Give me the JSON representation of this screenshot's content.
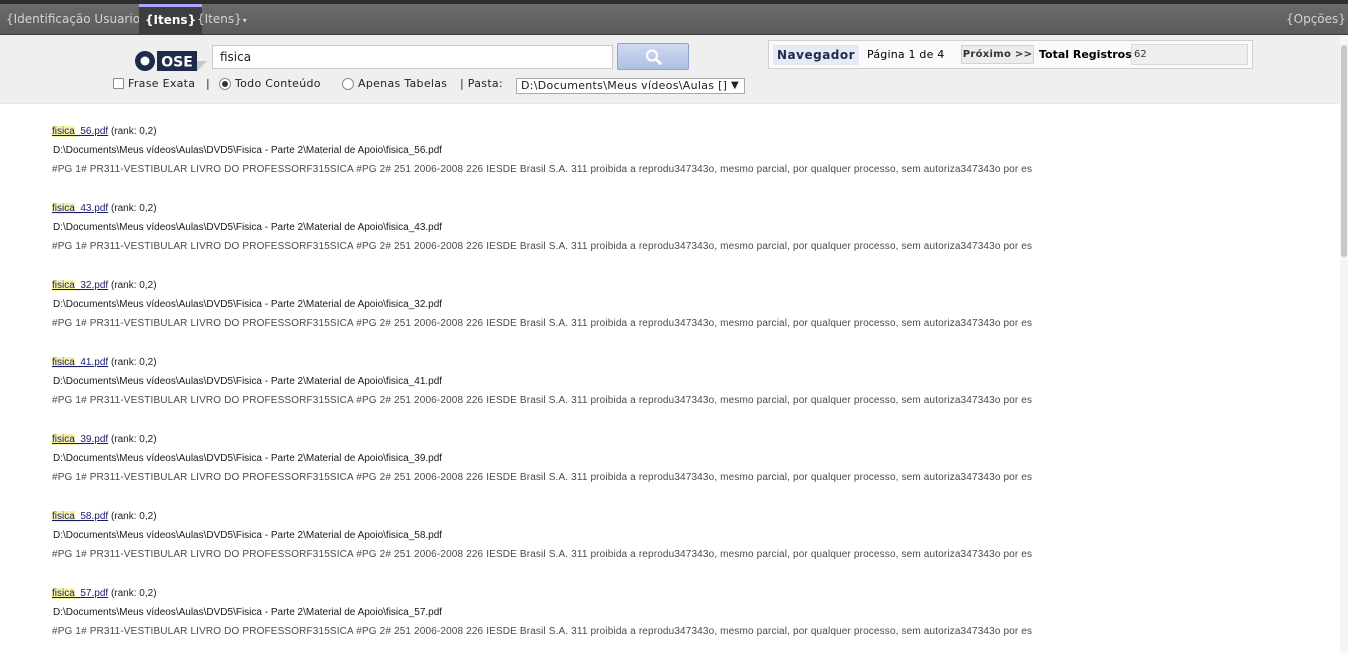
{
  "menu": {
    "identificacao": "{Identificação Usuario}",
    "itens_active": "{Itens}",
    "itens_dropdown": "{Itens}",
    "opcoes": "{Opções}"
  },
  "logo_text": "OSE",
  "search": {
    "query": "fisica",
    "button_icon": "search-icon"
  },
  "options": {
    "frase_exata": "Frase Exata",
    "frase_exata_checked": false,
    "sep1": "|",
    "todo_conteudo": "Todo Conteúdo",
    "todo_conteudo_selected": true,
    "apenas_tabelas": "Apenas Tabelas",
    "apenas_tabelas_selected": false,
    "pasta_label": "| Pasta:",
    "pasta_value": "D:\\Documents\\Meus vídeos\\Aulas []"
  },
  "navigator": {
    "title": "Navegador",
    "page_text": "Página 1 de 4",
    "next_label": "Próximo >>",
    "total_label": "Total Registros:",
    "total_value": "62"
  },
  "results": [
    {
      "name_hl": "fisica",
      "name_rest": "_56.pdf",
      "rank": "(rank: 0,2)",
      "path": "D:\\Documents\\Meus vídeos\\Aulas\\DVD5\\Fisica - Parte 2\\Material de Apoio\\fisica_56.pdf",
      "snippet": "#PG 1# PR311-VESTIBULAR LIVRO DO PROFESSORF315SICA #PG 2# 251 2006-2008 226 IESDE Brasil S.A. 311 proibida a reprodu347343o, mesmo parcial, por qualquer processo, sem autoriza347343o por es"
    },
    {
      "name_hl": "fisica",
      "name_rest": "_43.pdf",
      "rank": "(rank: 0,2)",
      "path": "D:\\Documents\\Meus vídeos\\Aulas\\DVD5\\Fisica - Parte 2\\Material de Apoio\\fisica_43.pdf",
      "snippet": "#PG 1# PR311-VESTIBULAR LIVRO DO PROFESSORF315SICA #PG 2# 251 2006-2008 226 IESDE Brasil S.A. 311 proibida a reprodu347343o, mesmo parcial, por qualquer processo, sem autoriza347343o por es"
    },
    {
      "name_hl": "fisica",
      "name_rest": "_32.pdf",
      "rank": "(rank: 0,2)",
      "path": "D:\\Documents\\Meus vídeos\\Aulas\\DVD5\\Fisica - Parte 2\\Material de Apoio\\fisica_32.pdf",
      "snippet": "#PG 1# PR311-VESTIBULAR LIVRO DO PROFESSORF315SICA #PG 2# 251 2006-2008 226 IESDE Brasil S.A. 311 proibida a reprodu347343o, mesmo parcial, por qualquer processo, sem autoriza347343o por es"
    },
    {
      "name_hl": "fisica",
      "name_rest": "_41.pdf",
      "rank": "(rank: 0,2)",
      "path": "D:\\Documents\\Meus vídeos\\Aulas\\DVD5\\Fisica - Parte 2\\Material de Apoio\\fisica_41.pdf",
      "snippet": "#PG 1# PR311-VESTIBULAR LIVRO DO PROFESSORF315SICA #PG 2# 251 2006-2008 226 IESDE Brasil S.A. 311 proibida a reprodu347343o, mesmo parcial, por qualquer processo, sem autoriza347343o por es"
    },
    {
      "name_hl": "fisica",
      "name_rest": "_39.pdf",
      "rank": "(rank: 0,2)",
      "path": "D:\\Documents\\Meus vídeos\\Aulas\\DVD5\\Fisica - Parte 2\\Material de Apoio\\fisica_39.pdf",
      "snippet": "#PG 1# PR311-VESTIBULAR LIVRO DO PROFESSORF315SICA #PG 2# 251 2006-2008 226 IESDE Brasil S.A. 311 proibida a reprodu347343o, mesmo parcial, por qualquer processo, sem autoriza347343o por es"
    },
    {
      "name_hl": "fisica",
      "name_rest": "_58.pdf",
      "rank": "(rank: 0,2)",
      "path": "D:\\Documents\\Meus vídeos\\Aulas\\DVD5\\Fisica - Parte 2\\Material de Apoio\\fisica_58.pdf",
      "snippet": "#PG 1# PR311-VESTIBULAR LIVRO DO PROFESSORF315SICA #PG 2# 251 2006-2008 226 IESDE Brasil S.A. 311 proibida a reprodu347343o, mesmo parcial, por qualquer processo, sem autoriza347343o por es"
    },
    {
      "name_hl": "fisica",
      "name_rest": "_57.pdf",
      "rank": "(rank: 0,2)",
      "path": "D:\\Documents\\Meus vídeos\\Aulas\\DVD5\\Fisica - Parte 2\\Material de Apoio\\fisica_57.pdf",
      "snippet": "#PG 1# PR311-VESTIBULAR LIVRO DO PROFESSORF315SICA #PG 2# 251 2006-2008 226 IESDE Brasil S.A. 311 proibida a reprodu347343o, mesmo parcial, por qualquer processo, sem autoriza347343o por es"
    }
  ]
}
